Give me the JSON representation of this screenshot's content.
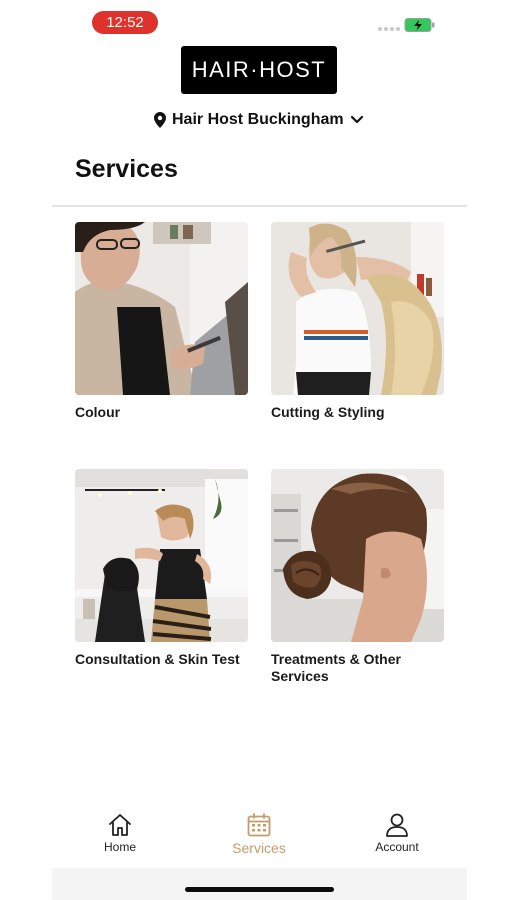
{
  "status_bar": {
    "time": "12:52"
  },
  "header": {
    "logo_text": "HAIR·HOST",
    "location": "Hair Host Buckingham"
  },
  "page": {
    "title": "Services"
  },
  "services": [
    {
      "label": "Colour"
    },
    {
      "label": "Cutting & Styling"
    },
    {
      "label": "Consultation & Skin Test"
    },
    {
      "label": "Treatments & Other Services"
    }
  ],
  "tab_bar": {
    "active": "Services",
    "active_color": "#c49c6a",
    "items": [
      {
        "label": "Home",
        "icon": "home-icon"
      },
      {
        "label": "Services",
        "icon": "calendar-icon"
      },
      {
        "label": "Account",
        "icon": "user-icon"
      }
    ]
  },
  "colors": {
    "time_pill": "#e0322d",
    "battery": "#35c759",
    "logo_bg": "#000000"
  }
}
